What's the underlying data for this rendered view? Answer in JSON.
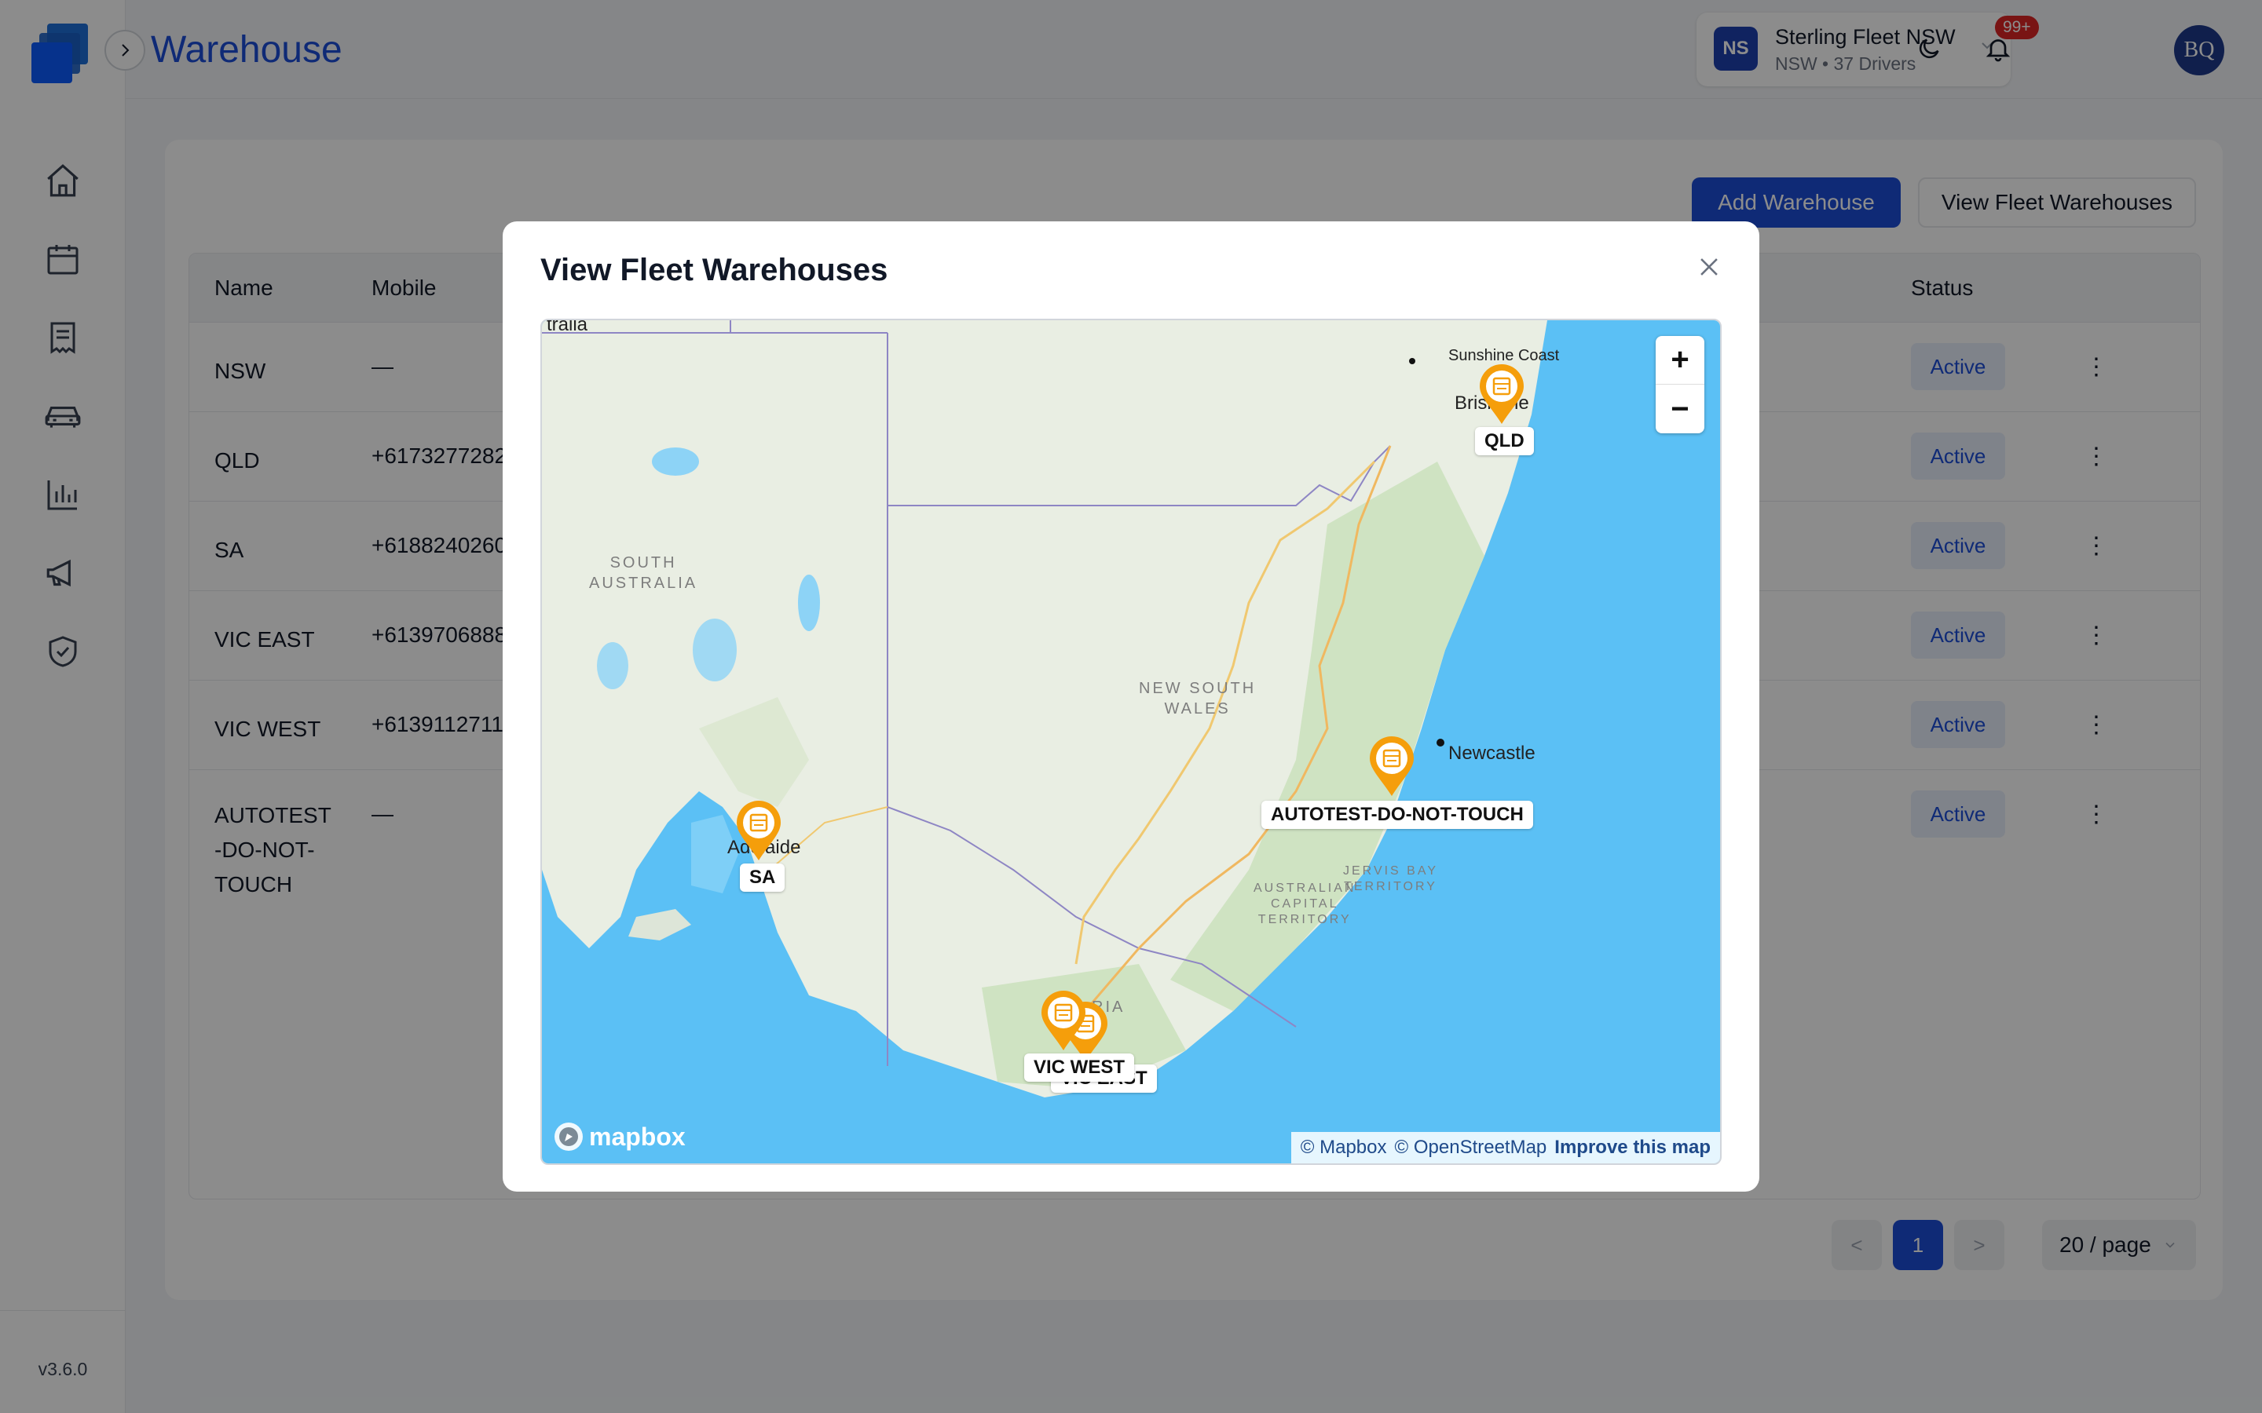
{
  "app": {
    "version": "v3.6.0"
  },
  "header": {
    "title": "Warehouse",
    "fleet": {
      "badge": "NS",
      "name": "Sterling Fleet NSW",
      "subtitle": "NSW • 37 Drivers"
    },
    "notifications_badge": "99+",
    "avatar_initials": "BQ"
  },
  "sidebar": {
    "items": [
      {
        "icon": "home-icon"
      },
      {
        "icon": "calendar-icon"
      },
      {
        "icon": "document-icon"
      },
      {
        "icon": "car-icon"
      },
      {
        "icon": "chart-icon"
      },
      {
        "icon": "megaphone-icon"
      },
      {
        "icon": "shield-check-icon"
      }
    ]
  },
  "toolbar": {
    "add_label": "Add Warehouse",
    "view_label": "View Fleet Warehouses"
  },
  "table": {
    "columns": {
      "name": "Name",
      "mobile": "Mobile",
      "status": "Status"
    },
    "rows": [
      {
        "name": "NSW",
        "mobile": "—",
        "status": "Active"
      },
      {
        "name": "QLD",
        "mobile": "+6173277282",
        "status": "Active"
      },
      {
        "name": "SA",
        "mobile": "+6188240260",
        "status": "Active"
      },
      {
        "name": "VIC EAST",
        "mobile": "+6139706888",
        "status": "Active"
      },
      {
        "name": "VIC WEST",
        "mobile": "+6139112711",
        "status": "Active"
      },
      {
        "name": "AUTOTEST\n-DO-NOT-\nTOUCH",
        "mobile": "—",
        "status": "Active"
      }
    ]
  },
  "pagination": {
    "current": "1",
    "page_size": "20 / page",
    "prev": "<",
    "next": ">"
  },
  "modal": {
    "title": "View Fleet Warehouses",
    "map": {
      "attribution_mapbox": "© Mapbox",
      "attribution_osm": "© OpenStreetMap",
      "improve": "Improve this map",
      "logo": "mapbox",
      "zoom_in": "+",
      "zoom_out": "−",
      "places": {
        "sunshine": "Sunshine Coast",
        "brisbane": "Brisbane",
        "newcastle": "Newcastle",
        "adelaide": "Adelaide",
        "australia_clip": "tralia"
      },
      "regions": {
        "sa": "SOUTH\nAUSTRALIA",
        "nsw": "NEW SOUTH\nWALES",
        "act": "AUSTRALIAN\nCAPITAL\nTERRITORY",
        "jervis": "JERVIS BAY\nTERRITORY",
        "vic": "RIA"
      },
      "markers": {
        "qld": "QLD",
        "autotest": "AUTOTEST-DO-NOT-TOUCH",
        "sa": "SA",
        "vic_west": "VIC WEST",
        "vic_east": "VIC EAST"
      }
    }
  },
  "colors": {
    "primary": "#1d4ed8",
    "marker": "#f59e0b",
    "sea": "#5bc0f5",
    "land": "#e9eee3"
  }
}
